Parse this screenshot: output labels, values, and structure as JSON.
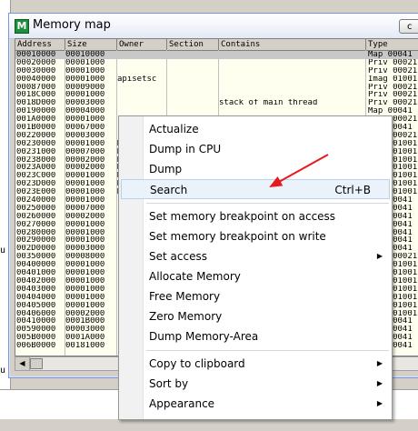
{
  "window": {
    "title": "Memory map",
    "app_icon": "M",
    "close_glyph": "c"
  },
  "columns": [
    "Address",
    "Size",
    "Owner",
    "Section",
    "Contains",
    "Type"
  ],
  "rows": [
    {
      "addr": "00010000",
      "size": "00010000",
      "owner": "",
      "section": "",
      "contains": "",
      "type": "Map  00041",
      "selected": true
    },
    {
      "addr": "00020000",
      "size": "00001000",
      "owner": "",
      "section": "",
      "contains": "",
      "type": "Priv 00021"
    },
    {
      "addr": "00030000",
      "size": "00001000",
      "owner": "",
      "section": "",
      "contains": "",
      "type": "Priv 00021"
    },
    {
      "addr": "00040000",
      "size": "00001000",
      "owner": "apisetsc",
      "section": "",
      "contains": "",
      "type": "Imag 01001"
    },
    {
      "addr": "00087000",
      "size": "00009000",
      "owner": "",
      "section": "",
      "contains": "",
      "type": "Priv 00021"
    },
    {
      "addr": "0018C000",
      "size": "00001000",
      "owner": "",
      "section": "",
      "contains": "",
      "type": "Priv 00021"
    },
    {
      "addr": "0018D000",
      "size": "00003000",
      "owner": "",
      "section": "",
      "contains": "stack of main thread",
      "type": "Priv 00021"
    },
    {
      "addr": "00190000",
      "size": "00004000",
      "owner": "",
      "section": "",
      "contains": "",
      "type": "Map  00041"
    },
    {
      "addr": "001A0000",
      "size": "00001000",
      "owner": "",
      "section": "",
      "contains": "",
      "type": "Priv 00021"
    },
    {
      "addr": "001B0000",
      "size": "00067000",
      "owner": "",
      "section": "",
      "contains": "",
      "type": "Map  00041"
    },
    {
      "addr": "00220000",
      "size": "00003000",
      "owner": "",
      "section": "",
      "contains": "",
      "type": "Priv 00021"
    },
    {
      "addr": "00230000",
      "size": "00001000",
      "owner": "M",
      "section": "",
      "contains": "",
      "type": "Imag 01001"
    },
    {
      "addr": "00231000",
      "size": "00007000",
      "owner": "M",
      "section": "",
      "contains": "",
      "type": "Imag 01001"
    },
    {
      "addr": "00238000",
      "size": "00002000",
      "owner": "M",
      "section": "",
      "contains": "",
      "type": "Imag 01001"
    },
    {
      "addr": "0023A000",
      "size": "00002000",
      "owner": "M",
      "section": "",
      "contains": "",
      "type": "Imag 01001"
    },
    {
      "addr": "0023C000",
      "size": "00001000",
      "owner": "M",
      "section": "",
      "contains": "",
      "type": "Imag 01001"
    },
    {
      "addr": "0023D000",
      "size": "00001000",
      "owner": "M",
      "section": "",
      "contains": "",
      "type": "Imag 01001"
    },
    {
      "addr": "0023E000",
      "size": "00001000",
      "owner": "M",
      "section": "",
      "contains": "",
      "type": "Imag 01001"
    },
    {
      "addr": "00240000",
      "size": "00001000",
      "owner": "",
      "section": "",
      "contains": "",
      "type": "Map  00041"
    },
    {
      "addr": "00250000",
      "size": "00007000",
      "owner": "",
      "section": "",
      "contains": "",
      "type": "Map  00041"
    },
    {
      "addr": "00260000",
      "size": "00002000",
      "owner": "",
      "section": "",
      "contains": "",
      "type": "Map  00041"
    },
    {
      "addr": "00270000",
      "size": "00001000",
      "owner": "",
      "section": "",
      "contains": "",
      "type": "Map  00041"
    },
    {
      "addr": "00280000",
      "size": "00001000",
      "owner": "",
      "section": "",
      "contains": "",
      "type": "Map  00041"
    },
    {
      "addr": "00290000",
      "size": "00001000",
      "owner": "",
      "section": "",
      "contains": "",
      "type": "Map  00041"
    },
    {
      "addr": "002D0000",
      "size": "00003000",
      "owner": "",
      "section": "",
      "contains": "",
      "type": "Map  00041"
    },
    {
      "addr": "00350000",
      "size": "00008000",
      "owner": "",
      "section": "",
      "contains": "",
      "type": "Priv 00021"
    },
    {
      "addr": "00400000",
      "size": "00001000",
      "owner": "F",
      "section": "",
      "contains": "",
      "type": "Imag 01001"
    },
    {
      "addr": "00401000",
      "size": "00001000",
      "owner": "F",
      "section": "",
      "contains": "",
      "type": "Imag 01001"
    },
    {
      "addr": "00402000",
      "size": "00001000",
      "owner": "F",
      "section": "",
      "contains": "",
      "type": "Imag 01001"
    },
    {
      "addr": "00403000",
      "size": "00001000",
      "owner": "F",
      "section": "",
      "contains": "",
      "type": "Imag 01001"
    },
    {
      "addr": "00404000",
      "size": "00001000",
      "owner": "F",
      "section": "",
      "contains": "",
      "type": "Imag 01001"
    },
    {
      "addr": "00405000",
      "size": "00001000",
      "owner": "F",
      "section": "",
      "contains": "",
      "type": "Imag 01001"
    },
    {
      "addr": "00406000",
      "size": "00002000",
      "owner": "F",
      "section": "",
      "contains": "",
      "type": "Imag 01001"
    },
    {
      "addr": "00410000",
      "size": "0001B000",
      "owner": "",
      "section": "",
      "contains": "",
      "type": "Map  00041"
    },
    {
      "addr": "00590000",
      "size": "00003000",
      "owner": "",
      "section": "",
      "contains": "",
      "type": "Map  00041"
    },
    {
      "addr": "005B0000",
      "size": "0001A000",
      "owner": "",
      "section": "",
      "contains": "",
      "type": "Map  00041"
    },
    {
      "addr": "006B0000",
      "size": "00181000",
      "owner": "",
      "section": "",
      "contains": "",
      "type": "Map  00041"
    }
  ],
  "background": {
    "left_marks": [
      "u",
      "u"
    ]
  },
  "context_menu": {
    "items": [
      {
        "label": "Actualize"
      },
      {
        "label": "Dump in CPU"
      },
      {
        "label": "Dump"
      },
      {
        "label": "Search",
        "shortcut": "Ctrl+B",
        "highlighted": true
      },
      {
        "label": "Set memory breakpoint on access"
      },
      {
        "label": "Set memory breakpoint on write"
      },
      {
        "label": "Set access",
        "submenu": true
      },
      {
        "label": "Allocate Memory"
      },
      {
        "label": "Free Memory"
      },
      {
        "label": "Zero Memory"
      },
      {
        "label": "Dump Memory-Area"
      },
      {
        "label": "Copy to clipboard",
        "submenu": true
      },
      {
        "label": "Sort by",
        "submenu": true
      },
      {
        "label": "Appearance",
        "submenu": true
      }
    ],
    "submenu_glyph": "▶"
  },
  "colors": {
    "menu_highlight": "#eaf2fc",
    "arrow": "#e8191b",
    "grid_bg": "#fffff0"
  }
}
